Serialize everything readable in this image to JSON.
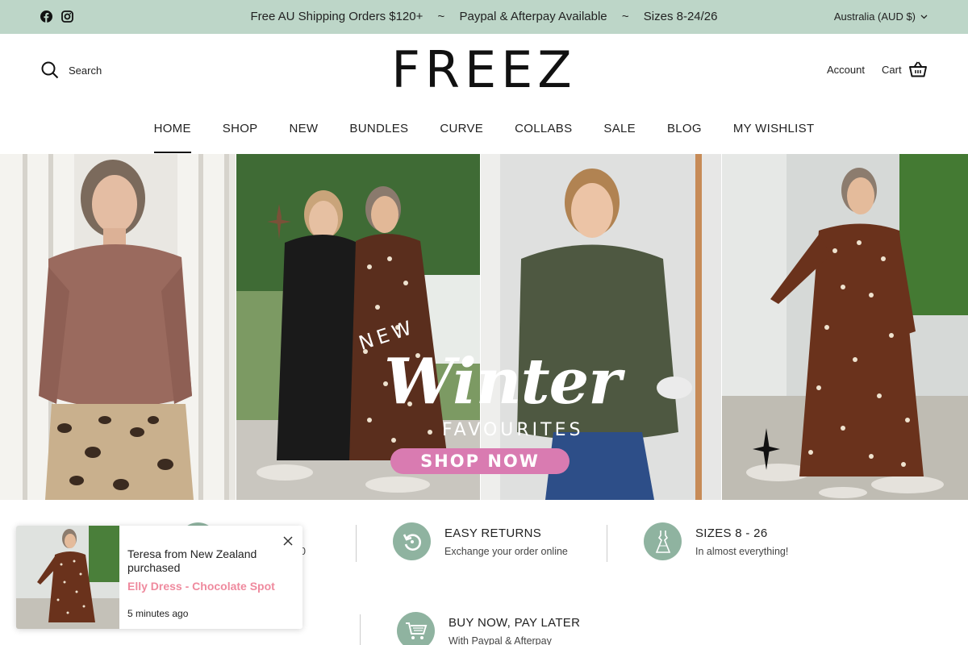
{
  "announcement": {
    "messages": [
      "Free AU Shipping Orders $120+",
      "Paypal & Afterpay Available",
      "Sizes 8-24/26"
    ],
    "separator": "~",
    "country": "Australia (AUD $)"
  },
  "social": {
    "icons": [
      "facebook-icon",
      "instagram-icon"
    ]
  },
  "header": {
    "search_label": "Search",
    "logo": "FREEZ",
    "account_label": "Account",
    "cart_label": "Cart"
  },
  "nav": {
    "items": [
      {
        "label": "HOME",
        "active": true
      },
      {
        "label": "SHOP"
      },
      {
        "label": "NEW"
      },
      {
        "label": "BUNDLES"
      },
      {
        "label": "CURVE"
      },
      {
        "label": "COLLABS"
      },
      {
        "label": "SALE"
      },
      {
        "label": "BLOG"
      },
      {
        "label": "MY WISHLIST"
      }
    ]
  },
  "hero": {
    "new_label": "NEW",
    "headline": "Winter",
    "subheadline": "FAVOURITES",
    "cta": "SHOP NOW"
  },
  "features": [
    {
      "title": "NG",
      "subtitle": "0",
      "icon": "shipping-icon"
    },
    {
      "title": "EASY RETURNS",
      "subtitle": "Exchange your order online",
      "icon": "returns-icon"
    },
    {
      "title": "SIZES 8 - 26",
      "subtitle": "In almost everything!",
      "icon": "dress-icon"
    },
    {
      "title": "BUY NOW, PAY LATER",
      "subtitle": "With Paypal & Afterpay",
      "icon": "cart-icon"
    }
  ],
  "popup": {
    "name": "Teresa from New Zealand purchased",
    "product": "Elly Dress - Chocolate Spot",
    "time": "5 minutes ago"
  },
  "colors": {
    "announcement_bg": "#bdd6c8",
    "accent_green": "#8fb3a0",
    "cta_pink": "#d97bb1",
    "product_pink": "#ef8a9e"
  }
}
